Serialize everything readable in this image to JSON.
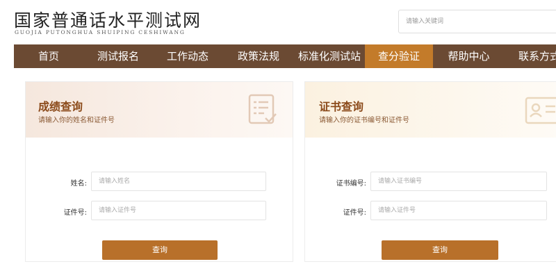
{
  "header": {
    "title": "国家普通话水平测试网",
    "subtitle": "GUOJIA PUTONGHUA SHUIPING CESHIWANG",
    "search_placeholder": "请输入关键词"
  },
  "nav": {
    "items": [
      {
        "label": "首页"
      },
      {
        "label": "测试报名"
      },
      {
        "label": "工作动态"
      },
      {
        "label": "政策法规"
      },
      {
        "label": "标准化测试站"
      },
      {
        "label": "查分验证"
      },
      {
        "label": "帮助中心"
      },
      {
        "label": "联系方式"
      }
    ],
    "active_index": 5
  },
  "score_query": {
    "title": "成绩查询",
    "subtitle": "请输入你的姓名和证件号",
    "icon": "document-check-icon",
    "name_label": "姓名:",
    "name_placeholder": "请输入姓名",
    "id_label": "证件号:",
    "id_placeholder": "请输入证件号",
    "button": "查询"
  },
  "cert_query": {
    "title": "证书查询",
    "subtitle": "请输入你的证书编号和证件号",
    "icon": "id-card-icon",
    "cert_label": "证书编号:",
    "cert_placeholder": "请输入证书编号",
    "id_label": "证件号:",
    "id_placeholder": "请输入证件号",
    "button": "查询"
  },
  "colors": {
    "nav_bg": "#6b4a33",
    "nav_active": "#c37b2a",
    "button": "#b8702a",
    "title": "#8b4a1a"
  }
}
